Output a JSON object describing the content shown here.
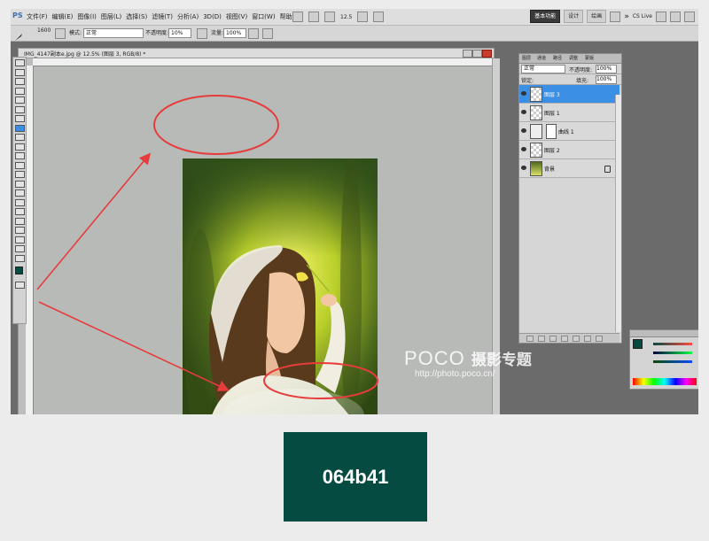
{
  "app": {
    "logo_text": "PS",
    "menu": [
      "文件(F)",
      "编辑(E)",
      "图像(I)",
      "图层(L)",
      "选择(S)",
      "滤镜(T)",
      "分析(A)",
      "3D(D)",
      "视图(V)",
      "窗口(W)",
      "帮助(H)"
    ],
    "zoom_display": "12.5",
    "workspace_buttons": [
      "基本功能",
      "设计",
      "绘画"
    ],
    "more_label": "»",
    "cslive_label": "CS Live"
  },
  "options_bar": {
    "brush_size": "1600",
    "mode_label": "模式:",
    "mode_value": "正常",
    "opacity_label": "不透明度:",
    "opacity_value": "10%",
    "flow_label": "流量:",
    "flow_value": "100%"
  },
  "document": {
    "title": "IMG_4147副本e.jpg @ 12.5% (图层 3, RGB/8) *"
  },
  "layers_panel": {
    "tabs": [
      "图层",
      "通道",
      "路径",
      "调整",
      "蒙版"
    ],
    "blend_mode": "正常",
    "opacity_label": "不透明度:",
    "opacity_value": "100%",
    "lock_label": "锁定:",
    "fill_label": "填充:",
    "fill_value": "100%",
    "layers": [
      {
        "name": "图层 3",
        "selected": true
      },
      {
        "name": "图层 1",
        "selected": false
      },
      {
        "name": "曲线 1",
        "selected": false
      },
      {
        "name": "图层 2",
        "selected": false
      },
      {
        "name": "背景",
        "selected": false
      }
    ]
  },
  "watermark": {
    "brand": "POCO",
    "brand_cn": "摄影专题",
    "url": "http://photo.poco.cn/"
  },
  "swatch": {
    "hex_label": "064b41",
    "color": "#064b41"
  },
  "annotation_color": "#e63c3c"
}
